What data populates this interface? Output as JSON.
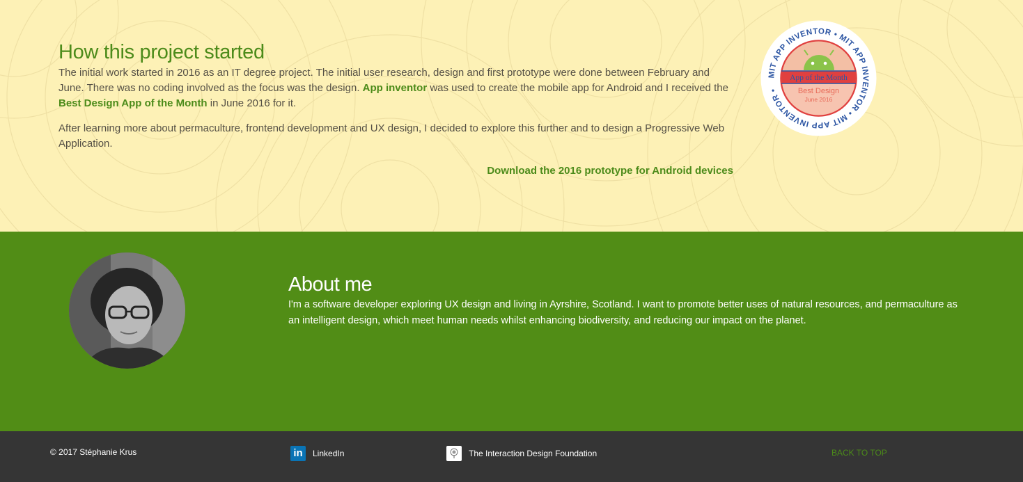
{
  "project": {
    "title": "How this project started",
    "p1_a": "The initial work started in 2016 as an IT degree project. The initial user research, design and first prototype were done between February and June. There was no coding involved as the focus was the design. ",
    "p1_link1": "App inventor",
    "p1_b": " was used to create the mobile app for Android and I received the ",
    "p1_link2": "Best Design App of the Month",
    "p1_c": " in June 2016 for it.",
    "p2": "After learning more about permaculture, frontend development and UX design, I decided to explore this further and to design a Progressive Web Application.",
    "download_label": "Download the 2016 prototype for Android devices",
    "badge": {
      "ring_text": "MIT APP INVENTOR • MIT APP INVENTOR • MIT APP INVENTOR •",
      "banner": "App of the Month",
      "award": "Best Design",
      "date": "June 2016"
    }
  },
  "about": {
    "title": "About me",
    "text": "I'm a software developer exploring UX design and living in Ayrshire, Scotland. I want to promote better uses of natural resources, and permaculture as an intelligent design, which meet human needs whilst enhancing biodiversity, and reducing our impact on the planet."
  },
  "footer": {
    "copyright": "© 2017 Stéphanie Krus",
    "linkedin_label": "LinkedIn",
    "linkedin_icon": "linkedin-icon",
    "idf_label": "The Interaction Design Foundation",
    "idf_icon": "tree-icon",
    "back_to_top": "BACK TO TOP"
  },
  "colors": {
    "accent_green": "#4c8b1a",
    "about_bg": "#518d16",
    "footer_bg": "#353535",
    "project_bg": "#fdf1b6"
  }
}
